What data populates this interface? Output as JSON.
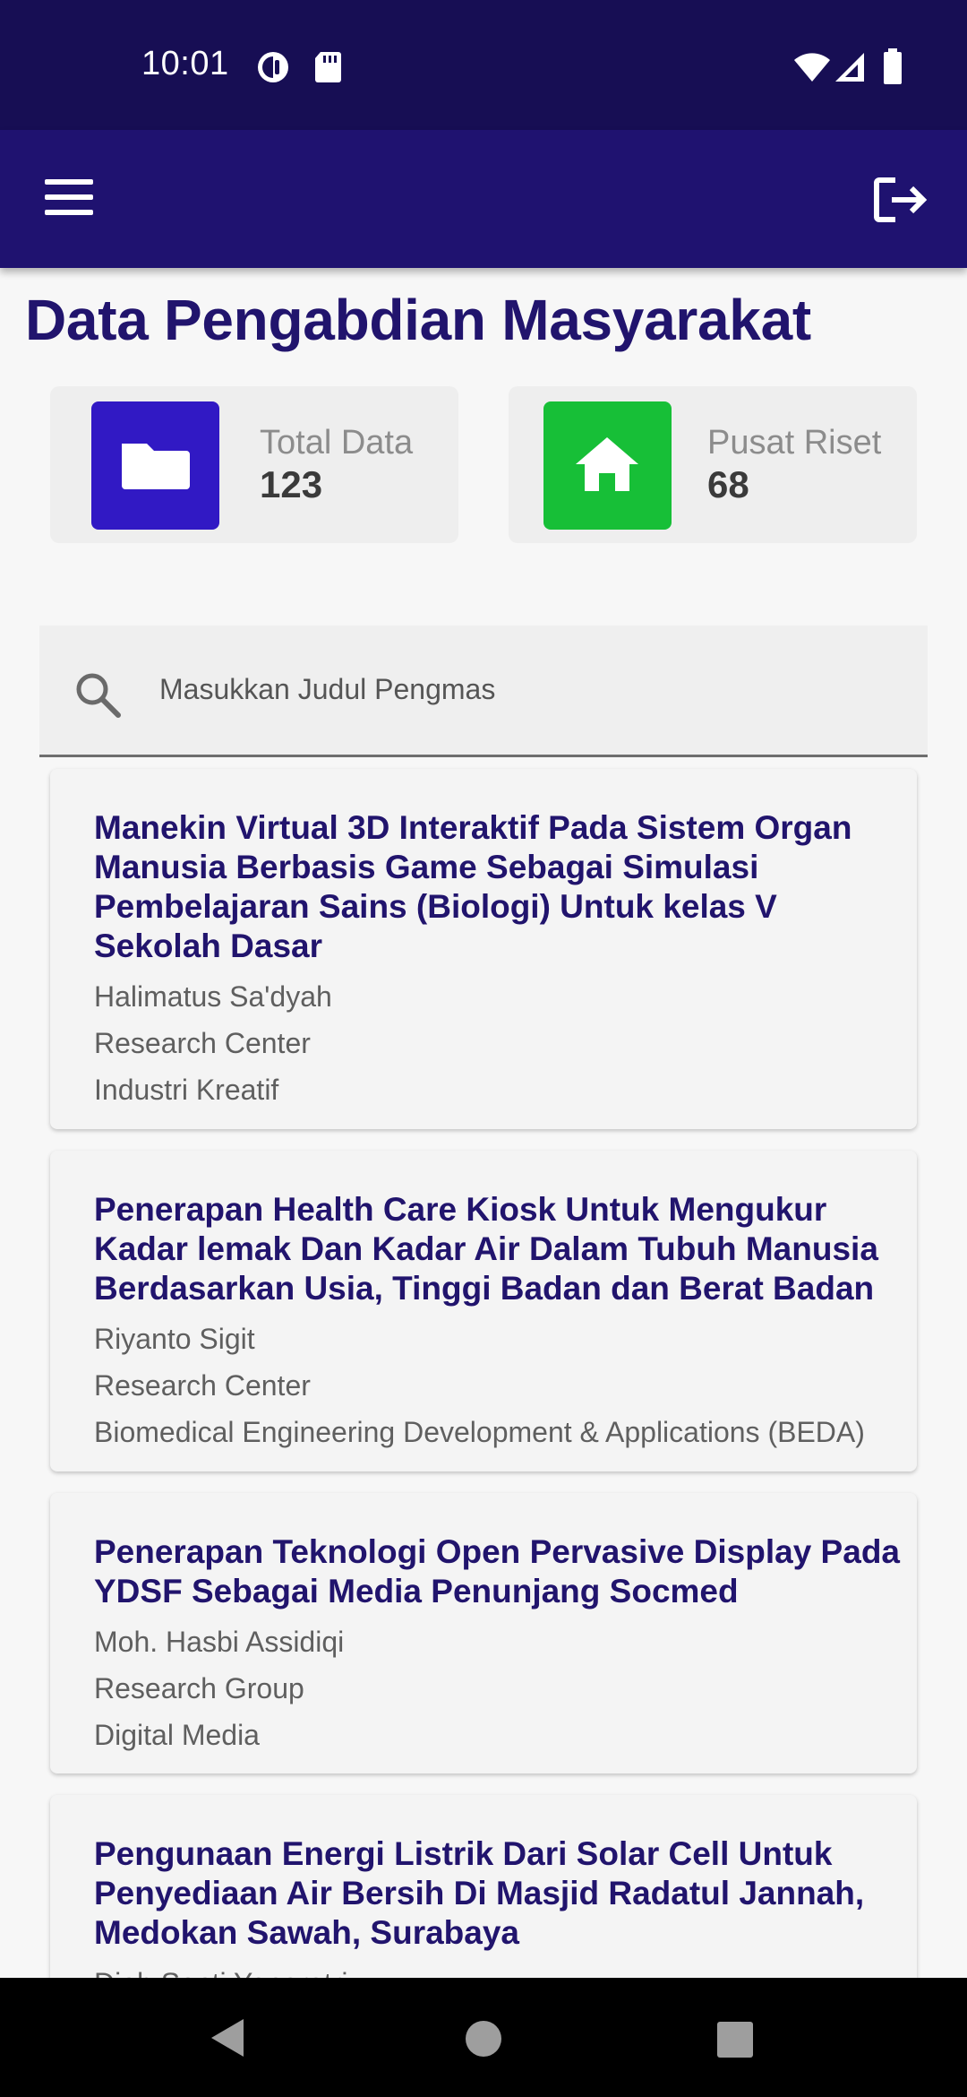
{
  "status_bar": {
    "time": "10:01",
    "left_icons": [
      "data-saver-icon",
      "sd-card-icon"
    ],
    "right_icons": [
      "wifi-icon",
      "cell-signal-icon",
      "battery-icon"
    ]
  },
  "app_bar": {
    "menu_icon": "hamburger-menu-icon",
    "logout_icon": "logout-icon",
    "color": "#1f1270"
  },
  "page": {
    "title": "Data Pengabdian Masyarakat"
  },
  "stats": [
    {
      "icon": "folder-icon",
      "icon_color": "#3119c4",
      "label": "Total Data",
      "value": "123"
    },
    {
      "icon": "home-icon",
      "icon_color": "#17bf37",
      "label": "Pusat Riset",
      "value": "68"
    }
  ],
  "search": {
    "placeholder": "Masukkan Judul Pengmas",
    "icon": "search-icon"
  },
  "items": [
    {
      "title": "Manekin Virtual 3D Interaktif Pada Sistem Organ Manusia Berbasis Game Sebagai Simulasi Pembelajaran Sains (Biologi) Untuk kelas V Sekolah Dasar",
      "author": "Halimatus Sa'dyah",
      "type": "Research Center",
      "group": "Industri Kreatif"
    },
    {
      "title": "Penerapan Health Care Kiosk Untuk Mengukur Kadar lemak Dan Kadar Air Dalam Tubuh Manusia Berdasarkan Usia, Tinggi Badan dan Berat Badan",
      "author": "Riyanto Sigit",
      "type": "Research Center",
      "group": "Biomedical Engineering Development & Applications (BEDA)"
    },
    {
      "title": "Penerapan Teknologi Open Pervasive Display Pada YDSF Sebagai Media Penunjang Socmed",
      "author": "Moh. Hasbi Assidiqi",
      "type": "Research Group",
      "group": "Digital Media"
    },
    {
      "title": "Pengunaan Energi Listrik Dari Solar Cell Untuk Penyediaan Air Bersih Di Masjid Radatul Jannah, Medokan Sawah, Surabaya",
      "author": "Diah Septi Yanaratri",
      "type": "",
      "group": ""
    }
  ],
  "nav_bar": {
    "buttons": [
      "back-icon",
      "home-circle-icon",
      "recents-icon"
    ]
  }
}
